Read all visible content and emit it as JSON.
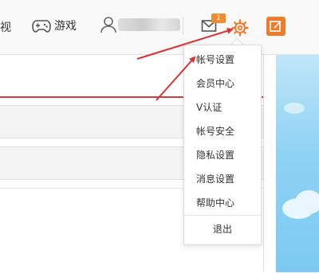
{
  "nav": {
    "cut_label": "视",
    "game_label": "游戏",
    "mail_badge": "1"
  },
  "dropdown": {
    "items": [
      "帐号设置",
      "会员中心",
      "V认证",
      "帐号安全",
      "隐私设置",
      "消息设置",
      "帮助中心"
    ],
    "logout": "退出"
  },
  "colors": {
    "accent_orange": "#f07b2a",
    "annotation_red": "#e03030",
    "sky_blue": "#8fd2f4"
  }
}
